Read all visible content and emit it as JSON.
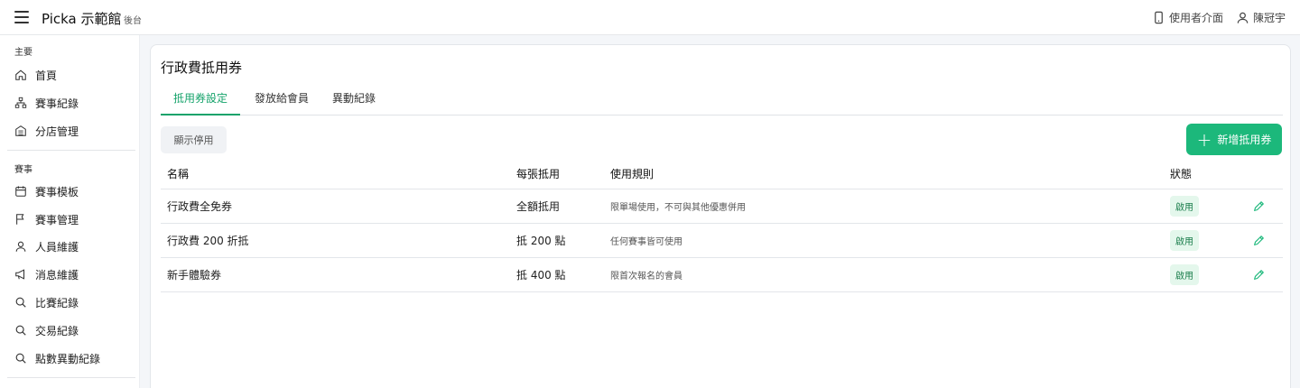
{
  "header": {
    "app_title": "Picka 示範館",
    "app_sub": "後台",
    "user_interface_label": "使用者介面",
    "user_name": "陳冠宇"
  },
  "sidebar": {
    "section_main": "主要",
    "main_items": [
      {
        "label": "首頁",
        "icon": "home-icon"
      },
      {
        "label": "賽事紀錄",
        "icon": "sitemap-icon"
      },
      {
        "label": "分店管理",
        "icon": "building-icon"
      }
    ],
    "section_event": "賽事",
    "event_items": [
      {
        "label": "賽事模板",
        "icon": "calendar-icon"
      },
      {
        "label": "賽事管理",
        "icon": "flag-icon"
      },
      {
        "label": "人員維護",
        "icon": "user-icon"
      },
      {
        "label": "消息維護",
        "icon": "megaphone-icon"
      },
      {
        "label": "比賽紀錄",
        "icon": "search-icon"
      },
      {
        "label": "交易紀錄",
        "icon": "search-icon"
      },
      {
        "label": "點數異動紀錄",
        "icon": "search-icon"
      }
    ]
  },
  "main": {
    "title": "行政費抵用券",
    "tabs": [
      {
        "label": "抵用券設定",
        "active": true
      },
      {
        "label": "發放給會員",
        "active": false
      },
      {
        "label": "異動紀錄",
        "active": false
      }
    ],
    "show_disabled_label": "顯示停用",
    "add_button_label": "新增抵用券",
    "table": {
      "headers": [
        "名稱",
        "每張抵用",
        "使用規則",
        "狀態"
      ],
      "rows": [
        {
          "name": "行政費全免券",
          "amount": "全額抵用",
          "rule": "限單場使用，不可與其他優惠併用",
          "status": "啟用"
        },
        {
          "name": "行政費 200 折抵",
          "amount": "抵 200 點",
          "rule": "任何賽事皆可使用",
          "status": "啟用"
        },
        {
          "name": "新手體驗券",
          "amount": "抵 400 點",
          "rule": "限首次報名的會員",
          "status": "啟用"
        }
      ]
    }
  },
  "colors": {
    "accent": "#16a36b",
    "primary_button": "#1cb87b",
    "badge_bg": "#e4f7ec",
    "badge_text": "#1a7d4b"
  }
}
